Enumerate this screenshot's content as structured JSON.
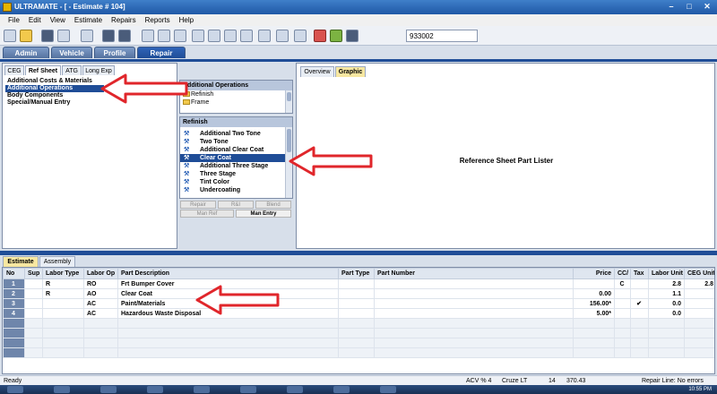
{
  "window": {
    "title": "ULTRAMATE - [ - Estimate # 104]"
  },
  "menu": [
    "File",
    "Edit",
    "View",
    "Estimate",
    "Repairs",
    "Reports",
    "Help"
  ],
  "toolbar": {
    "estimate_number": "933002"
  },
  "main_tabs": [
    "Admin",
    "Vehicle",
    "Profile",
    "Repair"
  ],
  "left_tabs": [
    "CEG",
    "Ref Sheet",
    "ATG",
    "Long Exp"
  ],
  "ref_items": [
    "Additional Costs & Materials",
    "Additional Operations",
    "Body Components",
    "Special/Manual Entry"
  ],
  "ops_box": {
    "header": "Additional Operations",
    "items": [
      "Refinish",
      "Frame"
    ]
  },
  "refinish_box": {
    "header": "Refinish",
    "items": [
      "Additional Two Tone",
      "Two Tone",
      "Additional Clear Coat",
      "Clear Coat",
      "Additional Three Stage",
      "Three Stage",
      "Tint Color",
      "Undercoating"
    ]
  },
  "action_buttons": [
    "Repair",
    "R&I",
    "Blend",
    "Man Ref",
    "Man Entry"
  ],
  "right_tabs": [
    "Overview",
    "Graphic"
  ],
  "right_panel": {
    "text": "Reference Sheet Part Lister"
  },
  "lower_tabs": [
    "Estimate",
    "Assembly"
  ],
  "grid": {
    "headers": [
      "No",
      "Sup",
      "Labor Type",
      "Labor Op",
      "Part Description",
      "Part Type",
      "Part Number",
      "Price",
      "CC/",
      "Tax",
      "Labor Unit",
      "CEG Unit"
    ],
    "rows": [
      [
        "1",
        "",
        "R",
        "RO",
        "Frt Bumper Cover",
        "",
        "",
        "",
        "C",
        "",
        "2.8",
        "2.8"
      ],
      [
        "2",
        "",
        "R",
        "AO",
        "Clear Coat",
        "",
        "",
        "0.00",
        "",
        "",
        "1.1",
        ""
      ],
      [
        "3",
        "",
        "",
        "AC",
        "Paint/Materials",
        "",
        "",
        "156.00*",
        "",
        "✔",
        "0.0",
        ""
      ],
      [
        "4",
        "",
        "",
        "AC",
        "Hazardous Waste Disposal",
        "",
        "",
        "5.00*",
        "",
        "",
        "0.0",
        ""
      ]
    ]
  },
  "status": {
    "left": "Ready",
    "acv": "ACV % 4",
    "vehicle": "Cruze LT",
    "num": "14",
    "amount": "370.43",
    "repair_line": "Repair Line: No errors"
  },
  "taskbar": {
    "clock": "10:55 PM"
  },
  "colors": {
    "title_bar": "#1f58a6",
    "selection": "#1f4d97",
    "arrow": "#e0262b"
  }
}
